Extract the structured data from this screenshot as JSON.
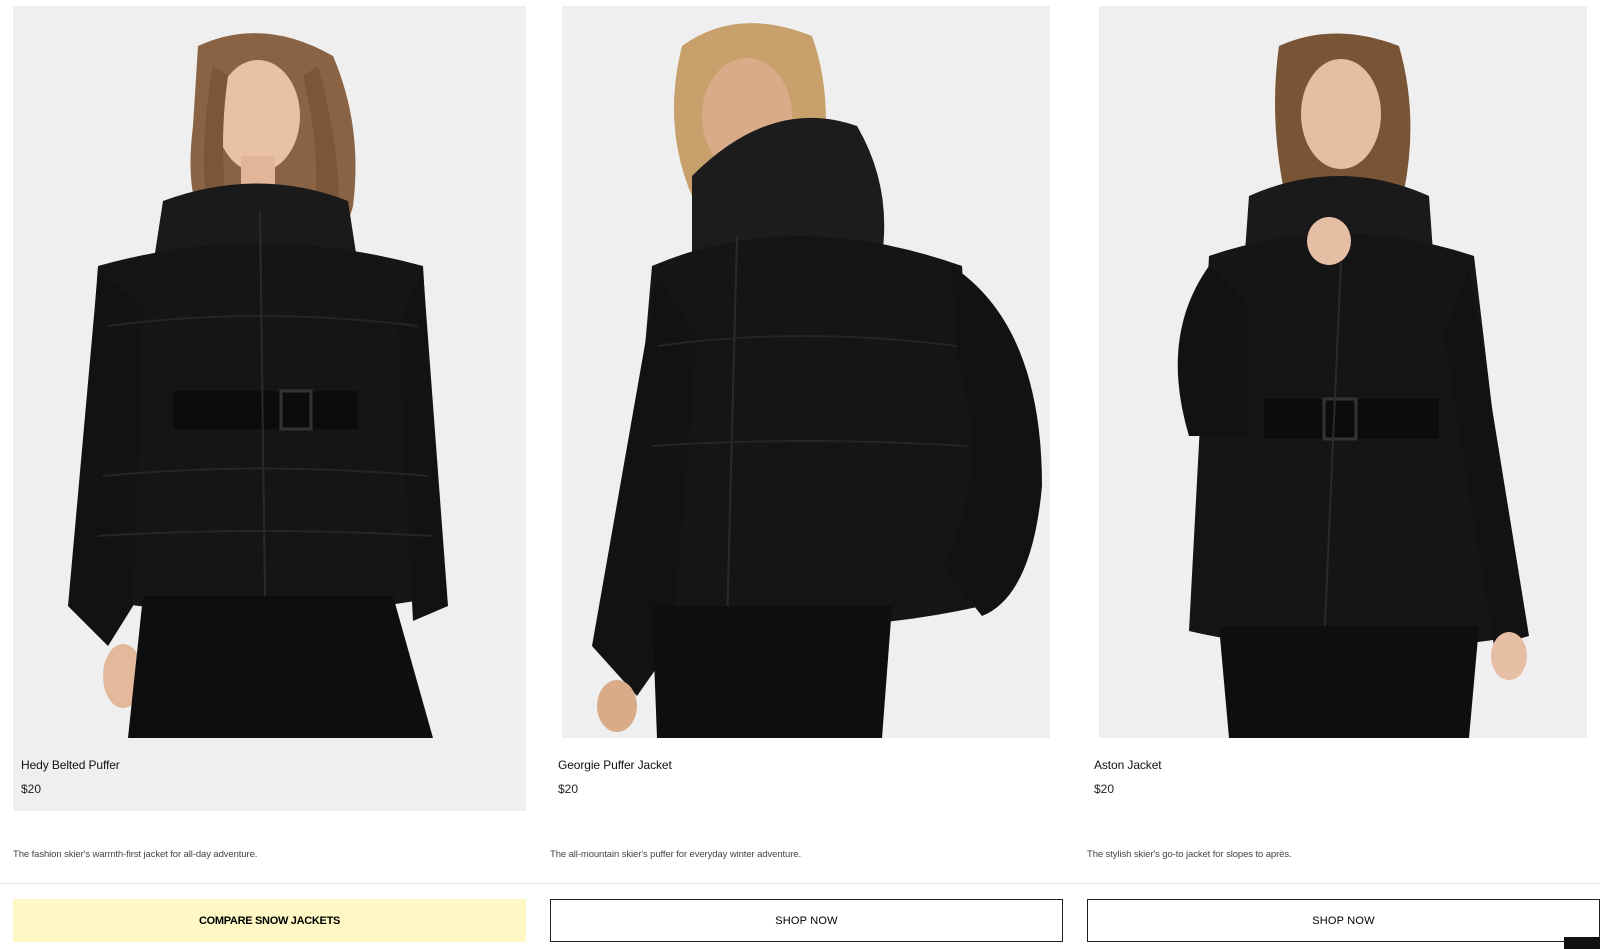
{
  "products": [
    {
      "name": "Hedy Belted Puffer",
      "price": "$20",
      "description": "The fashion skier's warmth-first jacket for all-day adventure.",
      "image_alt": "Model wearing black belted puffer jacket",
      "hair_color": "#8a6344"
    },
    {
      "name": "Georgie Puffer Jacket",
      "price": "$20",
      "description": "The all-mountain skier's puffer for everyday winter adventure.",
      "image_alt": "Model wearing black hooded puffer jacket",
      "hair_color": "#c7a06b"
    },
    {
      "name": "Aston Jacket",
      "price": "$20",
      "description": "The stylish skier's go-to jacket for slopes to après.",
      "image_alt": "Model wearing black belted ski jacket",
      "hair_color": "#7a5535"
    }
  ],
  "buttons": {
    "compare": "COMPARE SNOW JACKETS",
    "shop_1": "SHOP NOW",
    "shop_2": "SHOP NOW"
  },
  "colors": {
    "compare_bg": "#fff8c4",
    "card_bg": "#efefef",
    "jacket": "#151515"
  }
}
